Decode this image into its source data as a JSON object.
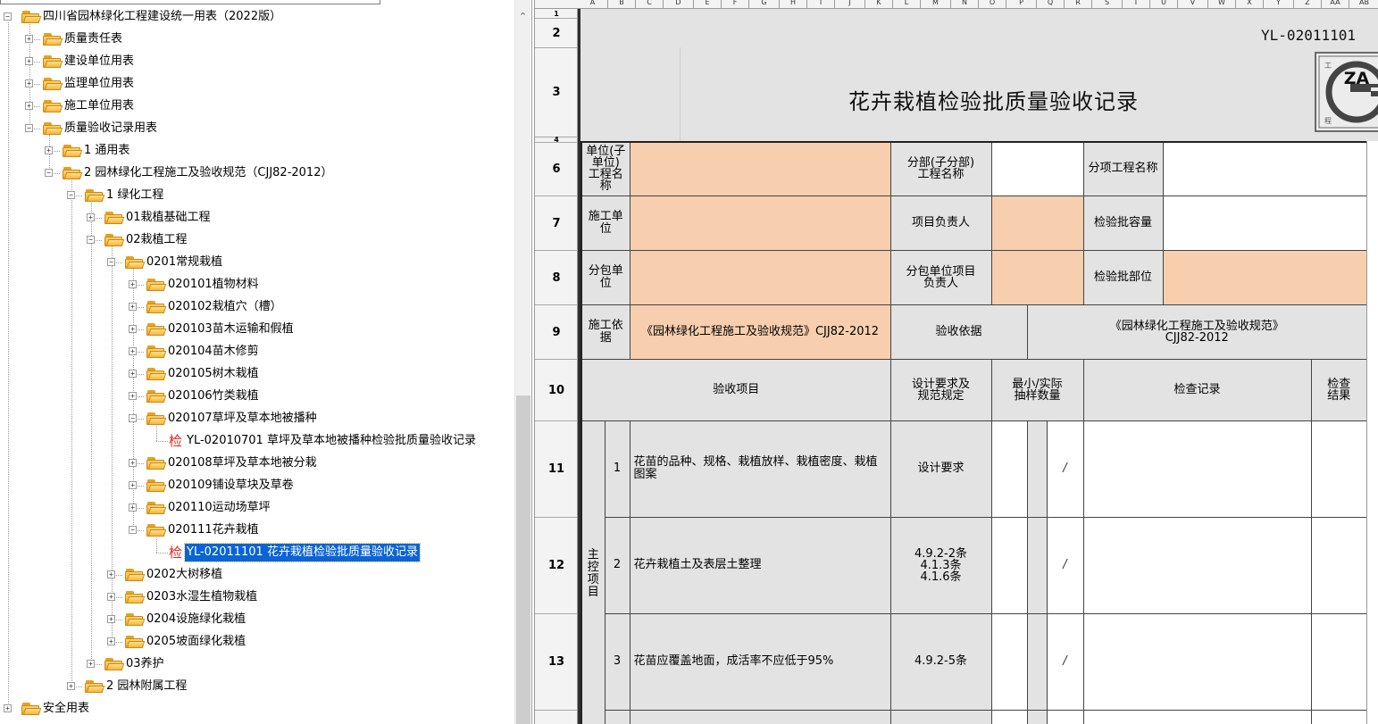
{
  "tree": {
    "root": "四川省园林绿化工程建设统一用表（2022版）",
    "items": [
      {
        "label": "质量责任表"
      },
      {
        "label": "建设单位用表"
      },
      {
        "label": "监理单位用表"
      },
      {
        "label": "施工单位用表"
      },
      {
        "label": "质量验收记录用表"
      },
      {
        "label": "1 通用表"
      },
      {
        "label": "2 园林绿化工程施工及验收规范（CJJ82-2012）"
      },
      {
        "label": "1 绿化工程"
      },
      {
        "label": "01栽植基础工程"
      },
      {
        "label": "02栽植工程"
      },
      {
        "label": "0201常规栽植"
      },
      {
        "label": "020101植物材料"
      },
      {
        "label": "020102栽植穴（槽）"
      },
      {
        "label": "020103苗木运输和假植"
      },
      {
        "label": "020104苗木修剪"
      },
      {
        "label": "020105树木栽植"
      },
      {
        "label": "020106竹类栽植"
      },
      {
        "label": "020107草坪及草本地被播种"
      },
      {
        "label": "YL-02010701 草坪及草本地被播种检验批质量验收记录"
      },
      {
        "label": "020108草坪及草本地被分栽"
      },
      {
        "label": "020109铺设草块及草卷"
      },
      {
        "label": "020110运动场草坪"
      },
      {
        "label": "020111花卉栽植"
      },
      {
        "label": "YL-02011101 花卉栽植检验批质量验收记录"
      },
      {
        "label": "0202大树移植"
      },
      {
        "label": "0203水湿生植物栽植"
      },
      {
        "label": "0204设施绿化栽植"
      },
      {
        "label": "0205坡面绿化栽植"
      },
      {
        "label": "03养护"
      },
      {
        "label": "2 园林附属工程"
      },
      {
        "label": "安全用表"
      }
    ],
    "check_glyph": "检",
    "expand_glyph": "+",
    "collapse_glyph": "−"
  },
  "sheet": {
    "column_letters": [
      "A",
      "B",
      "C",
      "D",
      "E",
      "F",
      "G",
      "H",
      "I",
      "J",
      "K",
      "L",
      "M",
      "N",
      "O",
      "P",
      "Q",
      "R",
      "S",
      "T",
      "U",
      "V",
      "W",
      "X",
      "Y",
      "Z",
      "AA",
      "AB",
      "AC"
    ],
    "row_numbers": [
      "1",
      "2",
      "3",
      "4",
      "6",
      "7",
      "8",
      "9",
      "10",
      "11",
      "12",
      "13"
    ],
    "doc_code": "YL-02011101",
    "title": "花卉栽植检验批质量验收记录",
    "logo_text": "ZA",
    "logo_corners": [
      "工",
      "建",
      "程",
      "设"
    ],
    "labels": {
      "unit_name": "单位(子单位)\n工程名称",
      "division_name": "分部(子分部)\n工程名称",
      "subitem_name": "分项工程名称",
      "construction_unit": "施工单位",
      "project_lead": "项目负责人",
      "batch_capacity": "检验批容量",
      "subcontractor": "分包单位",
      "subcontract_lead": "分包单位项目\n负责人",
      "batch_location": "检验批部位",
      "construction_basis": "施工依据",
      "construction_basis_value": "《园林绿化工程施工及验收规范》CJJ82-2012",
      "acceptance_basis": "验收依据",
      "acceptance_basis_value": "《园林绿化工程施工及验收规范》\nCJJ82-2012",
      "acceptance_items": "验收项目",
      "design_requirement": "设计要求及\n规范规定",
      "sample_count": "最小/实际\n抽样数量",
      "inspection_record": "检查记录",
      "inspection_result": "检查\n结果",
      "main_control": "主\n控\n项\n目"
    },
    "items": [
      {
        "no": "1",
        "text": "花苗的品种、规格、栽植放样、栽植密度、栽植图案",
        "requirement": "设计要求",
        "slash": "/"
      },
      {
        "no": "2",
        "text": "花卉栽植土及表层土整理",
        "requirement": "4.9.2-2条\n4.1.3条\n4.1.6条",
        "slash": "/"
      },
      {
        "no": "3",
        "text": "花苗应覆盖地面，成活率不应低于95%",
        "requirement": "4.9.2-5条",
        "slash": "/"
      }
    ]
  }
}
